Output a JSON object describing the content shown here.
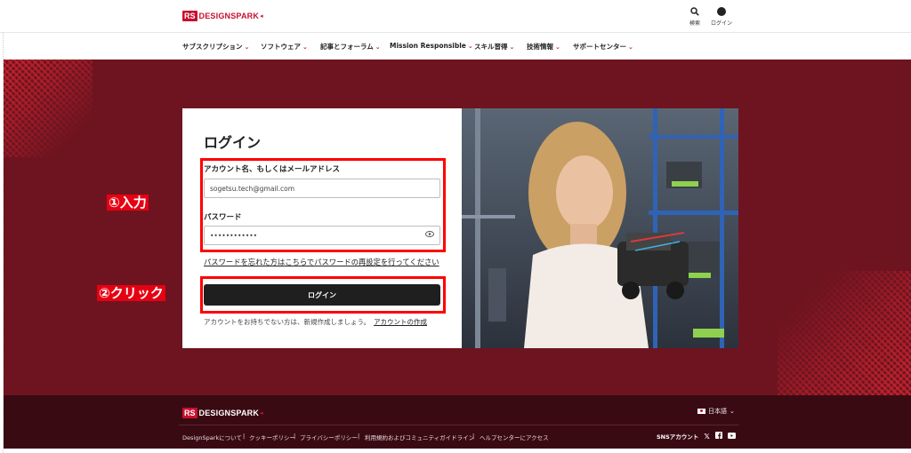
{
  "header": {
    "logo_rs": "RS",
    "logo_text": "DESIGNSPARK",
    "search_label": "検索",
    "login_label": "ログイン"
  },
  "nav": {
    "items": [
      {
        "label": "サブスクリプション"
      },
      {
        "label": "ソフトウェア"
      },
      {
        "label": "記事とフォーラム"
      },
      {
        "label": "Mission Responsible"
      },
      {
        "label": "スキル習得"
      },
      {
        "label": "技術情報"
      },
      {
        "label": "サポートセンター"
      }
    ]
  },
  "login": {
    "title": "ログイン",
    "account_label": "アカウント名、もしくはメールアドレス",
    "account_value": "sogetsu.tech@gmail.com",
    "password_label": "パスワード",
    "password_value": "••••••••••••",
    "forgot_link": "パスワードを忘れた方はこちらでパスワードの再設定を行ってください",
    "submit": "ログイン",
    "signup_text": "アカウントをお持ちでない方は、新規作成しましょう。",
    "signup_link": "アカウントの作成"
  },
  "annotations": {
    "step1": "①入力",
    "step2": "②クリック",
    "color": "#ff0000"
  },
  "footer": {
    "logo_rs": "RS",
    "logo_text": "DESIGNSPARK",
    "language": "日本語",
    "links": [
      "DesignSparkについて",
      "|",
      "クッキーポリシー",
      "|",
      "プライバシーポリシー",
      "|",
      "利用規約およびコミュニティガイドライン",
      "|",
      "ヘルプセンターにアクセス"
    ],
    "sns_label": "SNSアカウント"
  },
  "colors": {
    "brand_red": "#c8102e",
    "hero_bg": "#6e1420",
    "footer_bg": "#3a0a12"
  }
}
